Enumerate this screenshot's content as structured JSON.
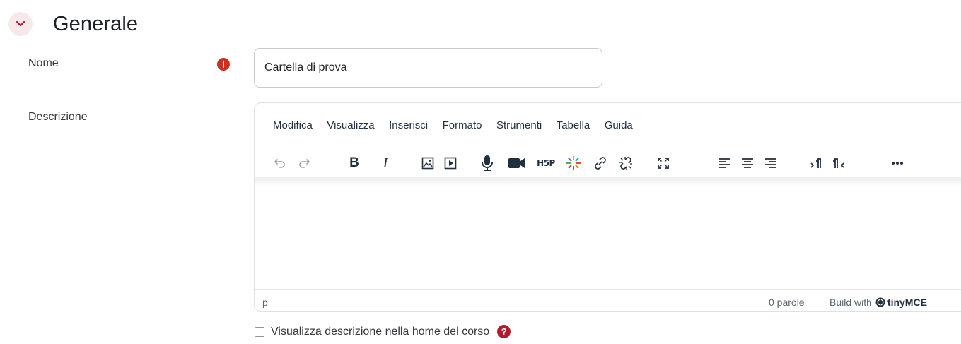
{
  "section": {
    "title": "Generale"
  },
  "name_field": {
    "label": "Nome",
    "value": "Cartella di prova",
    "required_icon": "exclamation-icon"
  },
  "description_field": {
    "label": "Descrizione"
  },
  "editor": {
    "menu": [
      "Modifica",
      "Visualizza",
      "Inserisci",
      "Formato",
      "Strumenti",
      "Tabella",
      "Guida"
    ],
    "status_path": "p",
    "word_count": "0 parole",
    "brand_prefix": "Build with",
    "brand_name": "tinyMCE"
  },
  "checkbox": {
    "label": "Visualizza descrizione nella home del corso",
    "checked": false
  },
  "colors": {
    "accent": "#ca3120",
    "help": "#b01c2e",
    "collapse_bg": "#f7e8ea"
  }
}
